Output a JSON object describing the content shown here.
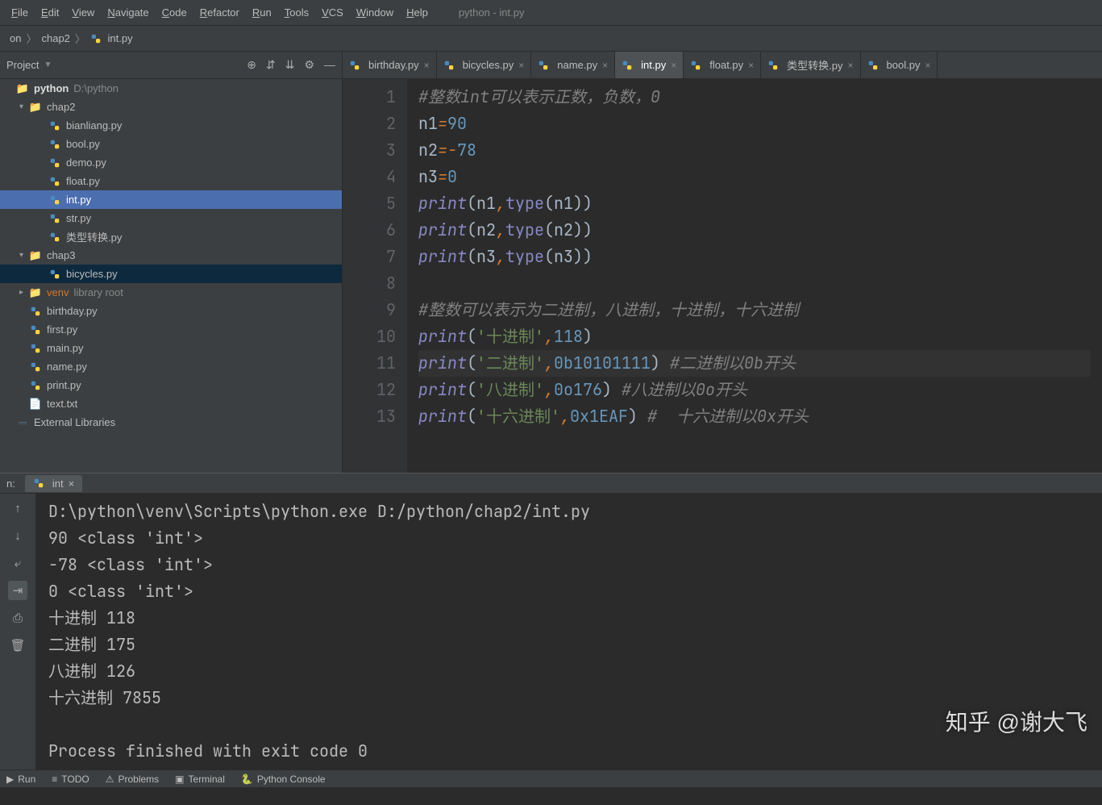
{
  "window_title": "python - int.py",
  "menu": [
    "File",
    "Edit",
    "View",
    "Navigate",
    "Code",
    "Refactor",
    "Run",
    "Tools",
    "VCS",
    "Window",
    "Help"
  ],
  "breadcrumbs": [
    "on",
    "chap2",
    "int.py"
  ],
  "sidebar": {
    "title": "Project",
    "tree": [
      {
        "depth": 0,
        "kind": "folder",
        "label": "python",
        "hint": "D:\\python",
        "bold": true,
        "arrow": ""
      },
      {
        "depth": 1,
        "kind": "folder",
        "label": "chap2",
        "arrow": "▾"
      },
      {
        "depth": 2,
        "kind": "py",
        "label": "bianliang.py"
      },
      {
        "depth": 2,
        "kind": "py",
        "label": "bool.py"
      },
      {
        "depth": 2,
        "kind": "py",
        "label": "demo.py"
      },
      {
        "depth": 2,
        "kind": "py",
        "label": "float.py"
      },
      {
        "depth": 2,
        "kind": "py",
        "label": "int.py",
        "selected": true
      },
      {
        "depth": 2,
        "kind": "py",
        "label": "str.py"
      },
      {
        "depth": 2,
        "kind": "py",
        "label": "类型转换.py"
      },
      {
        "depth": 1,
        "kind": "folder",
        "label": "chap3",
        "arrow": "▾"
      },
      {
        "depth": 2,
        "kind": "py",
        "label": "bicycles.py",
        "highlighted": true
      },
      {
        "depth": 1,
        "kind": "folder",
        "label": "venv",
        "hint": "library root",
        "arrow": "▸",
        "orange": true
      },
      {
        "depth": 1,
        "kind": "py",
        "label": "birthday.py"
      },
      {
        "depth": 1,
        "kind": "py",
        "label": "first.py"
      },
      {
        "depth": 1,
        "kind": "py",
        "label": "main.py"
      },
      {
        "depth": 1,
        "kind": "py",
        "label": "name.py"
      },
      {
        "depth": 1,
        "kind": "py",
        "label": "print.py"
      },
      {
        "depth": 1,
        "kind": "txt",
        "label": "text.txt"
      },
      {
        "depth": 0,
        "kind": "lib",
        "label": "External Libraries"
      }
    ]
  },
  "tabs": [
    {
      "label": "birthday.py"
    },
    {
      "label": "bicycles.py"
    },
    {
      "label": "name.py"
    },
    {
      "label": "int.py",
      "active": true
    },
    {
      "label": "float.py"
    },
    {
      "label": "类型转换.py"
    },
    {
      "label": "bool.py"
    }
  ],
  "code_lines": [
    {
      "n": 1,
      "html": "<span class='comment'>#整数int可以表示正数，负数，0</span>"
    },
    {
      "n": 2,
      "html": "n1<span class='kw'>=</span><span class='num'>90</span>"
    },
    {
      "n": 3,
      "html": "n2<span class='kw'>=-</span><span class='num'>78</span>"
    },
    {
      "n": 4,
      "html": "n3<span class='kw'>=</span><span class='num'>0</span>"
    },
    {
      "n": 5,
      "html": "<span class='fn'>print</span>(n1<span class='kw'>,</span><span class='builtin'>type</span>(n1))"
    },
    {
      "n": 6,
      "html": "<span class='fn'>print</span>(n2<span class='kw'>,</span><span class='builtin'>type</span>(n2))"
    },
    {
      "n": 7,
      "html": "<span class='fn'>print</span>(n3<span class='kw'>,</span><span class='builtin'>type</span>(n3))"
    },
    {
      "n": 8,
      "html": ""
    },
    {
      "n": 9,
      "html": "<span class='comment'>#整数可以表示为二进制，八进制，十进制，十六进制</span>"
    },
    {
      "n": 10,
      "html": "<span class='fn'>print</span>(<span class='str'>'十进制'</span><span class='kw'>,</span><span class='num'>118</span>)"
    },
    {
      "n": 11,
      "html": "<span class='fn'>print</span>(<span class='str'>'二进制'</span><span class='kw'>,</span><span class='num'>0b10101111</span>)<span class='comment'> #二进制以0b开头</span>",
      "current": true
    },
    {
      "n": 12,
      "html": "<span class='fn'>print</span>(<span class='str'>'八进制'</span><span class='kw'>,</span><span class='num'>0o176</span>)<span class='comment'> #八进制以0o开头</span>"
    },
    {
      "n": 13,
      "html": "<span class='fn'>print</span>(<span class='str'>'十六进制'</span><span class='kw'>,</span><span class='num'>0x1EAF</span>)<span class='comment'> #  十六进制以0x开头</span>"
    }
  ],
  "run_tab_prefix": "n:",
  "run_tab": "int",
  "console_lines": [
    "D:\\python\\venv\\Scripts\\python.exe D:/python/chap2/int.py",
    "90 <class 'int'>",
    "-78 <class 'int'>",
    "0 <class 'int'>",
    "十进制 118",
    "二进制 175",
    "八进制 126",
    "十六进制 7855",
    "",
    "Process finished with exit code 0"
  ],
  "statusbar": {
    "run": "Run",
    "todo": "TODO",
    "problems": "Problems",
    "terminal": "Terminal",
    "py_console": "Python Console"
  },
  "watermark": "知乎 @谢大飞"
}
